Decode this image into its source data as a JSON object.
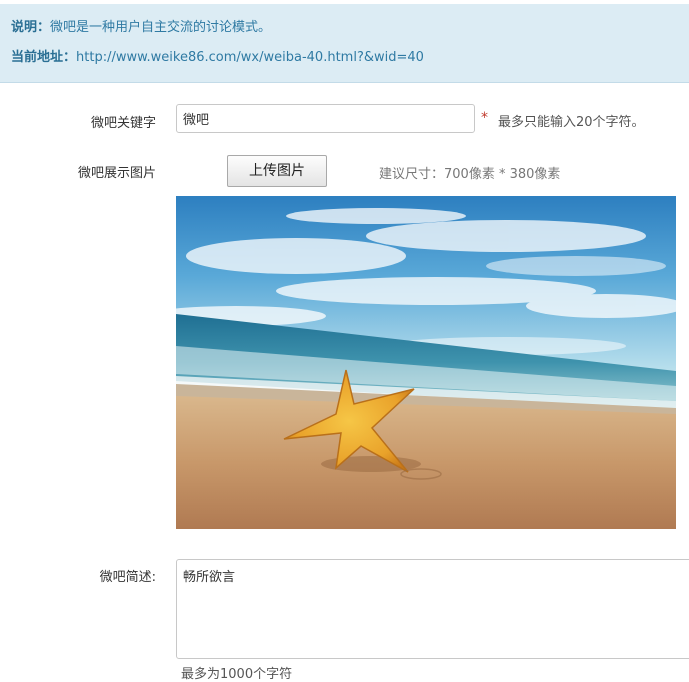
{
  "notice": {
    "desc_label": "说明：",
    "desc_text": "微吧是一种用户自主交流的讨论模式。",
    "addr_label": "当前地址：",
    "addr_url": "http://www.weike86.com/wx/weiba-40.html?&wid=40"
  },
  "keyword": {
    "label": "微吧关键字",
    "value": "微吧",
    "required_mark": "*",
    "hint": "最多只能输入20个字符。"
  },
  "image": {
    "label": "微吧展示图片",
    "upload_button": "上传图片",
    "size_hint": "建议尺寸：700像素 * 380像素",
    "preview_subject": "beach with starfish"
  },
  "description": {
    "label": "微吧简述:",
    "value": "畅所欲言",
    "hint": "最多为1000个字符"
  }
}
